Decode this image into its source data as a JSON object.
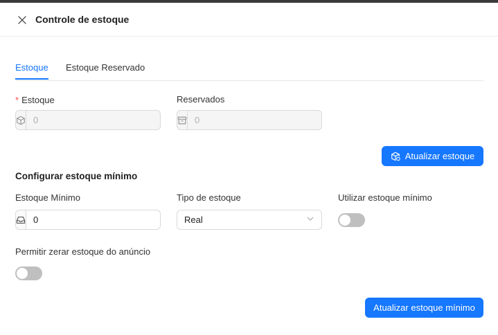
{
  "header": {
    "title": "Controle de estoque"
  },
  "tabs": [
    {
      "label": "Estoque",
      "active": true
    },
    {
      "label": "Estoque Reservado",
      "active": false
    }
  ],
  "stock": {
    "label": "Estoque",
    "required_mark": "*",
    "value": "0",
    "icon": "package-icon"
  },
  "reserved": {
    "label": "Reservados",
    "value": "0",
    "icon": "archive-icon"
  },
  "update_stock_button": {
    "label": "Atualizar estoque",
    "icon": "package-refresh-icon"
  },
  "min_config": {
    "title": "Configurar estoque mínimo",
    "min_stock": {
      "label": "Estoque Mínimo",
      "value": "0",
      "icon": "inbox-icon"
    },
    "stock_type": {
      "label": "Tipo de estoque",
      "selected": "Real"
    },
    "use_min": {
      "label": "Utilizar estoque mínimo",
      "enabled": false
    },
    "allow_zero": {
      "label": "Permitir zerar estoque do anúncio",
      "enabled": false
    },
    "update_button": {
      "label": "Atualizar estoque mínimo"
    }
  },
  "colors": {
    "primary": "#1677ff",
    "required": "#ff4d4f",
    "switch_off": "#bfbfbf"
  }
}
